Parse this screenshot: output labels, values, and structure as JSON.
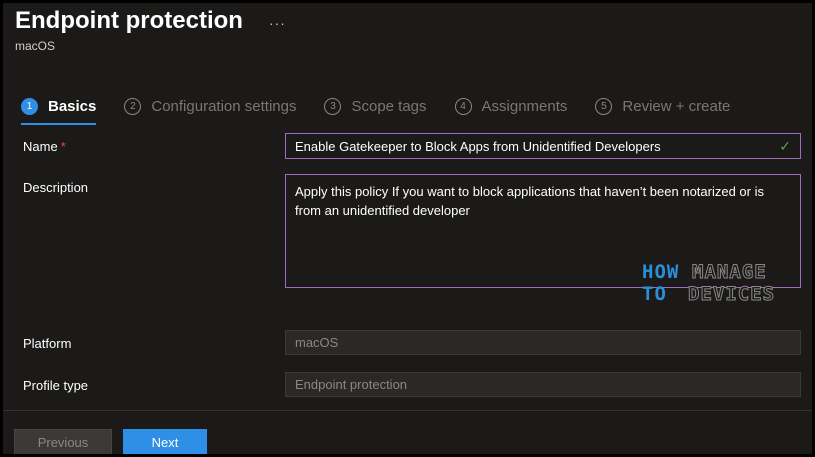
{
  "header": {
    "title": "Endpoint protection",
    "more_icon": "···",
    "subtitle": "macOS"
  },
  "tabs": [
    {
      "num": "1",
      "label": "Basics",
      "active": true
    },
    {
      "num": "2",
      "label": "Configuration settings"
    },
    {
      "num": "3",
      "label": "Scope tags"
    },
    {
      "num": "4",
      "label": "Assignments"
    },
    {
      "num": "5",
      "label": "Review + create"
    }
  ],
  "form": {
    "name_label": "Name",
    "required_mark": "*",
    "name_value": "Enable Gatekeeper to Block Apps from Unidentified Developers",
    "check_icon": "✓",
    "description_label": "Description",
    "description_value": "Apply this policy If you want to block applications that haven’t been notarized or is from an unidentified developer",
    "platform_label": "Platform",
    "platform_value": "macOS",
    "profile_type_label": "Profile type",
    "profile_type_value": "Endpoint protection"
  },
  "watermark": {
    "line1a": "HOW",
    "line1b": "MANAGE",
    "line2a": "TO",
    "line2b": "DEVICES"
  },
  "footer": {
    "previous_label": "Previous",
    "next_label": "Next"
  },
  "colors": {
    "accent": "#2f8fe6",
    "focus_border": "#a06bc2",
    "required": "#e8483b",
    "valid": "#57a64a"
  }
}
